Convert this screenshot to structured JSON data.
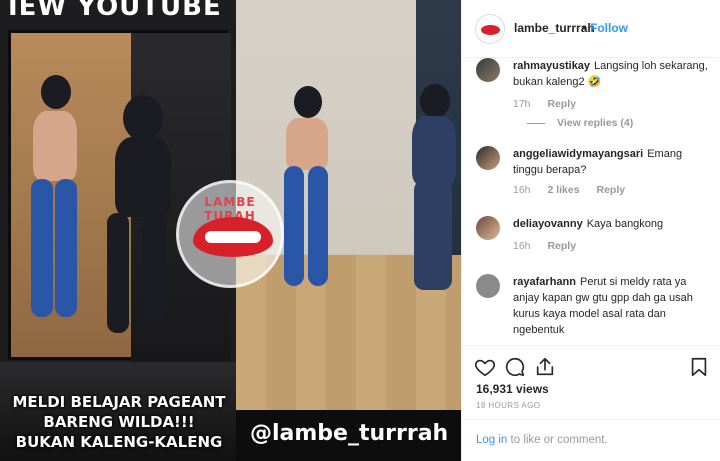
{
  "media": {
    "top_caption": "IEW YOUTUBE",
    "caption_lines": [
      "MELDI BELAJAR PAGEANT",
      "BARENG WILDA!!!",
      "BUKAN KALENG-KALENG"
    ],
    "handle": "@lambe_turrrah",
    "watermark_text": "LAMBE TURAH"
  },
  "header": {
    "username": "lambe_turrrah",
    "separator": "•",
    "follow_label": "Follow"
  },
  "comments": [
    {
      "user": "rahmayustikay",
      "text": "Langsing loh sekarang, bukan kaleng2 🤣",
      "time": "17h",
      "likes": "",
      "reply": "Reply",
      "view_replies": "View replies (4)"
    },
    {
      "user": "anggeliawidymayangsari",
      "text": "Emang tinggu berapa?",
      "time": "16h",
      "likes": "2 likes",
      "reply": "Reply",
      "view_replies": ""
    },
    {
      "user": "deliayovanny",
      "text": "Kaya bangkong",
      "time": "16h",
      "likes": "",
      "reply": "Reply",
      "view_replies": ""
    },
    {
      "user": "rayafarhann",
      "text": "Perut si meldy rata ya anjay kapan gw gtu gpp dah ga usah kurus kaya model asal rata dan ngebentuk",
      "time": "",
      "likes": "",
      "reply": "",
      "view_replies": ""
    }
  ],
  "footer": {
    "views": "16,931 views",
    "time_ago": "18 HOURS AGO",
    "login_link": "Log in",
    "login_rest": " to like or comment."
  },
  "colors": {
    "link_blue": "#3897f0",
    "muted": "#999999",
    "text": "#262626",
    "brand_red": "#d8202b"
  },
  "icons": [
    "heart-icon",
    "comment-icon",
    "share-icon",
    "bookmark-icon"
  ]
}
